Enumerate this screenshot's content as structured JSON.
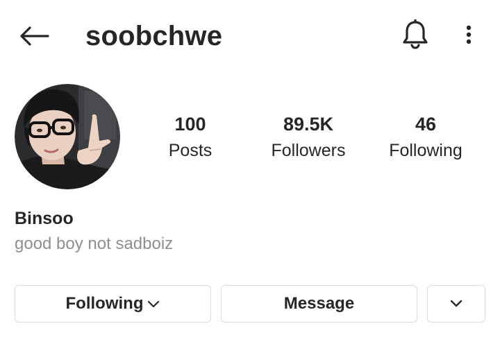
{
  "header": {
    "username": "soobchwe",
    "back_icon": "arrow-left-icon",
    "notification_icon": "bell-icon",
    "more_icon": "more-vertical-icon"
  },
  "profile": {
    "avatar": "profile-photo",
    "stats": [
      {
        "value": "100",
        "label": "Posts"
      },
      {
        "value": "89.5K",
        "label": "Followers"
      },
      {
        "value": "46",
        "label": "Following"
      }
    ],
    "display_name": "Binsoo",
    "bio": "good boy not sadboiz"
  },
  "actions": {
    "following_label": "Following",
    "message_label": "Message",
    "dropdown_icon": "chevron-down-icon"
  },
  "colors": {
    "text_primary": "#262626",
    "text_secondary": "#8e8e8e",
    "border": "#dbdbdb"
  }
}
